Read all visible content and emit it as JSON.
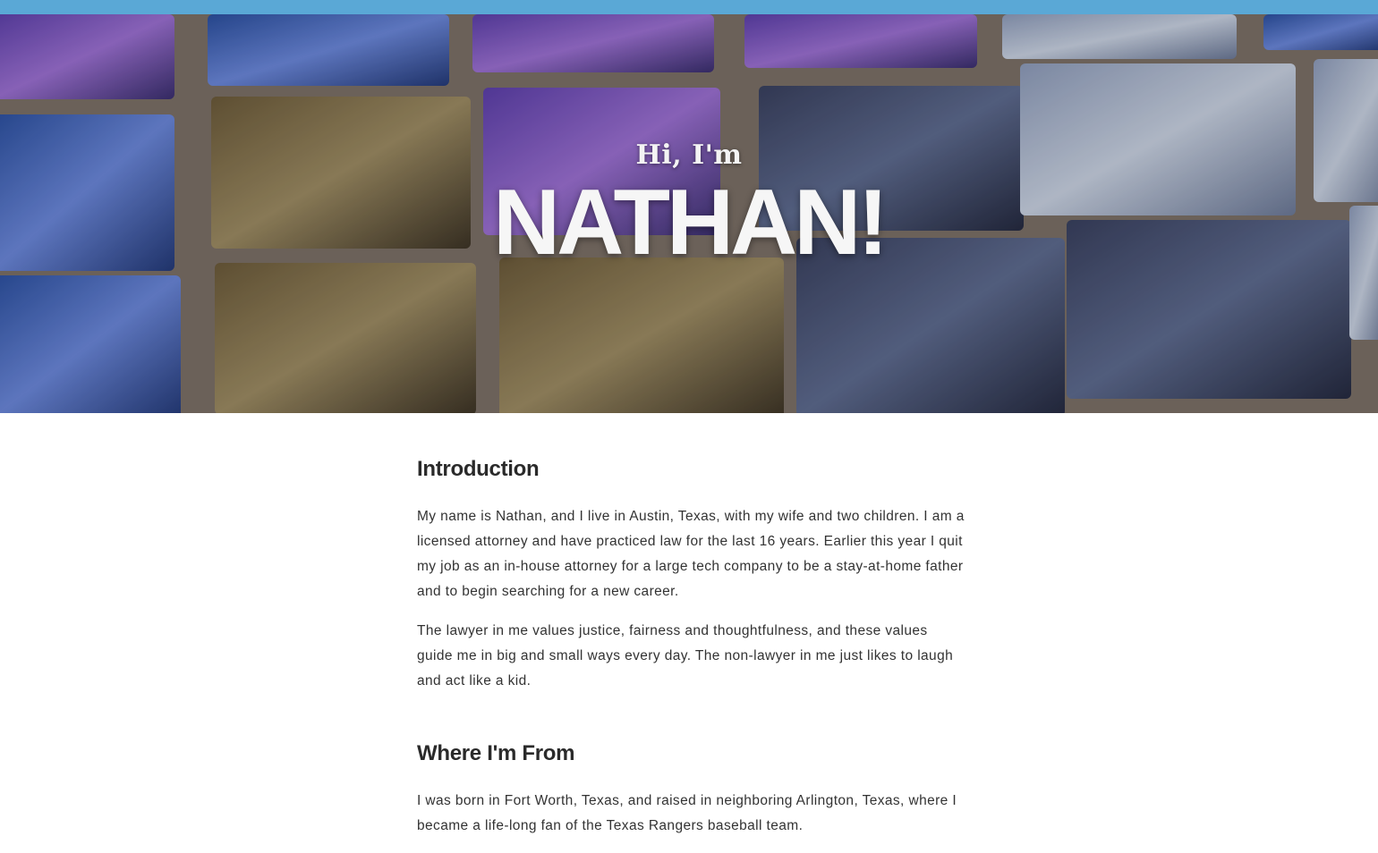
{
  "colors": {
    "top_bar": "#5aa8d6",
    "hero_text": "#f6f6f6",
    "body_text": "#333333"
  },
  "hero": {
    "greeting": "Hi, I'm",
    "name": "NATHAN!",
    "background": "iridescent-glass-mosaic-tiles-image"
  },
  "sections": [
    {
      "heading": "Introduction",
      "paragraphs": [
        "My name is Nathan, and I live in Austin, Texas, with my wife and two children. I am a licensed attorney and have practiced law for the last 16 years. Earlier this year I quit my job as an in-house attorney for a large tech company to be a stay-at-home father and to begin searching for a new career.",
        "The lawyer in me values justice, fairness and thoughtfulness, and these values guide me in big and small ways every day. The non-lawyer in me just likes to laugh and act like a kid."
      ]
    },
    {
      "heading": "Where I'm From",
      "paragraphs": [
        "I was born in Fort Worth, Texas, and raised in neighboring Arlington, Texas, where I became a life-long fan of the Texas Rangers baseball team."
      ]
    }
  ]
}
